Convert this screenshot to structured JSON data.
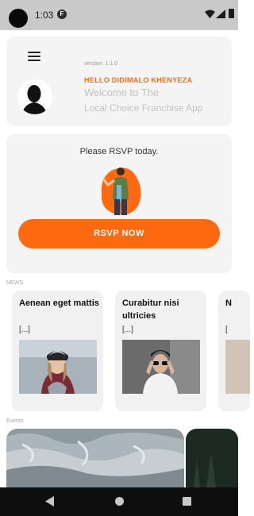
{
  "status_bar": {
    "time": "1:03",
    "notification_icon": "F"
  },
  "welcome": {
    "version": "version: 1.1.0",
    "greeting": "HELLO DIDIMALO KHENYEZA",
    "line1": "Welcome to The",
    "line2": "Local Choice Franchise App"
  },
  "rsvp": {
    "prompt": "Please RSVP today.",
    "button": "RSVP NOW"
  },
  "sections": {
    "news": "NEWS",
    "events": "Events"
  },
  "news": [
    {
      "title": "Aenean eget mattis",
      "excerpt": "[...]"
    },
    {
      "title": "Curabitur nisi ultricies",
      "excerpt": "[...]"
    },
    {
      "title": "N",
      "excerpt": "["
    }
  ],
  "colors": {
    "accent": "#ff6a10",
    "card": "#f4f4f4"
  }
}
